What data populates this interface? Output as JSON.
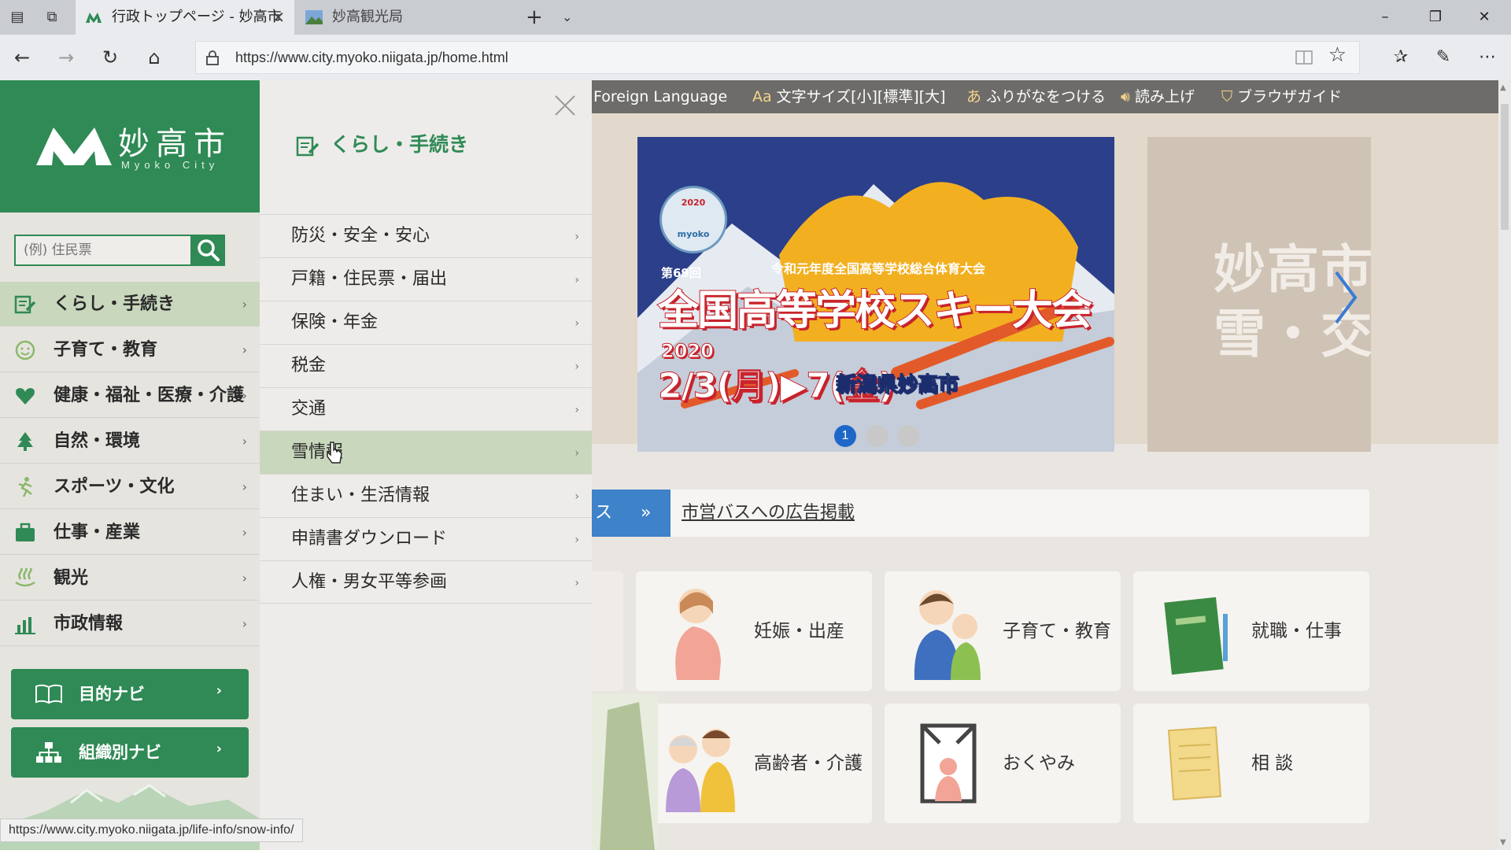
{
  "browser": {
    "tabs": [
      {
        "title": "行政トップページ - 妙高市",
        "active": true
      },
      {
        "title": "妙高観光局",
        "active": false
      }
    ],
    "url": "https://www.city.myoko.niigata.jp/home.html",
    "status_url": "https://www.city.myoko.niigata.jp/life-info/snow-info/"
  },
  "utility": {
    "foreign_language": "Foreign Language",
    "font_size_icon": "Aa",
    "font_size": "文字サイズ[小][標準][大]",
    "furigana_icon": "あ",
    "furigana": "ふりがなをつける",
    "read_aloud": "読み上げ",
    "browser_guide": "ブラウザガイド"
  },
  "logo": {
    "name": "妙高市",
    "sub": "Myoko City"
  },
  "search": {
    "placeholder": "(例) 住民票"
  },
  "sidebar": {
    "items": [
      {
        "label": "くらし・手続き",
        "icon": "document-pencil-icon",
        "active": true
      },
      {
        "label": "子育て・教育",
        "icon": "smiley-icon"
      },
      {
        "label": "健康・福祉・医療・介護",
        "icon": "heart-icon"
      },
      {
        "label": "自然・環境",
        "icon": "tree-icon"
      },
      {
        "label": "スポーツ・文化",
        "icon": "running-person-icon"
      },
      {
        "label": "仕事・産業",
        "icon": "briefcase-icon"
      },
      {
        "label": "観光",
        "icon": "hot-spring-icon"
      },
      {
        "label": "市政情報",
        "icon": "bar-chart-icon"
      }
    ],
    "navi": [
      {
        "label": "目的ナビ",
        "icon": "open-book-icon"
      },
      {
        "label": "組織別ナビ",
        "icon": "org-chart-icon"
      }
    ]
  },
  "mega_menu": {
    "title": "くらし・手続き",
    "items": [
      {
        "label": "防災・安全・安心"
      },
      {
        "label": "戸籍・住民票・届出"
      },
      {
        "label": "保険・年金"
      },
      {
        "label": "税金"
      },
      {
        "label": "交通"
      },
      {
        "label": "雪情報",
        "active": true
      },
      {
        "label": "住まい・生活情報"
      },
      {
        "label": "申請書ダウンロード"
      },
      {
        "label": "人権・男女平等参画"
      }
    ]
  },
  "slideshow": {
    "emblem": "myoko",
    "emblem_year": "2020",
    "subtitle": "令和元年度全国高等学校総合体育大会",
    "round": "第69回",
    "title": "全国高等学校スキー大会",
    "year": "2020",
    "date": "2/3(月)▶7(金)",
    "place": "新潟県妙高市",
    "peek_text_1": "妙高市",
    "peek_text_2": "雪・交",
    "dots": [
      "1",
      "",
      ""
    ],
    "active_dot": 1
  },
  "notice": {
    "tag": "ス",
    "link": "市営バスへの広告掲載"
  },
  "cards": [
    {
      "label": "妊娠・出産",
      "icon": "pregnant-woman-icon"
    },
    {
      "label": "子育て・教育",
      "icon": "parent-child-icon"
    },
    {
      "label": "就職・仕事",
      "icon": "green-book-icon"
    },
    {
      "label": "高齢者・介護",
      "icon": "elderly-couple-icon"
    },
    {
      "label": "おくやみ",
      "icon": "memorial-frame-icon"
    },
    {
      "label": "相 談",
      "icon": "document-paper-icon"
    }
  ],
  "ghost": {
    "label_1": "まい"
  },
  "colors": {
    "brand_green": "#2f8a55",
    "active_bg": "#c9d8bd",
    "notice_blue": "#3e82c9",
    "slide_blue": "#2b3f8a",
    "title_red": "#c8232c"
  }
}
